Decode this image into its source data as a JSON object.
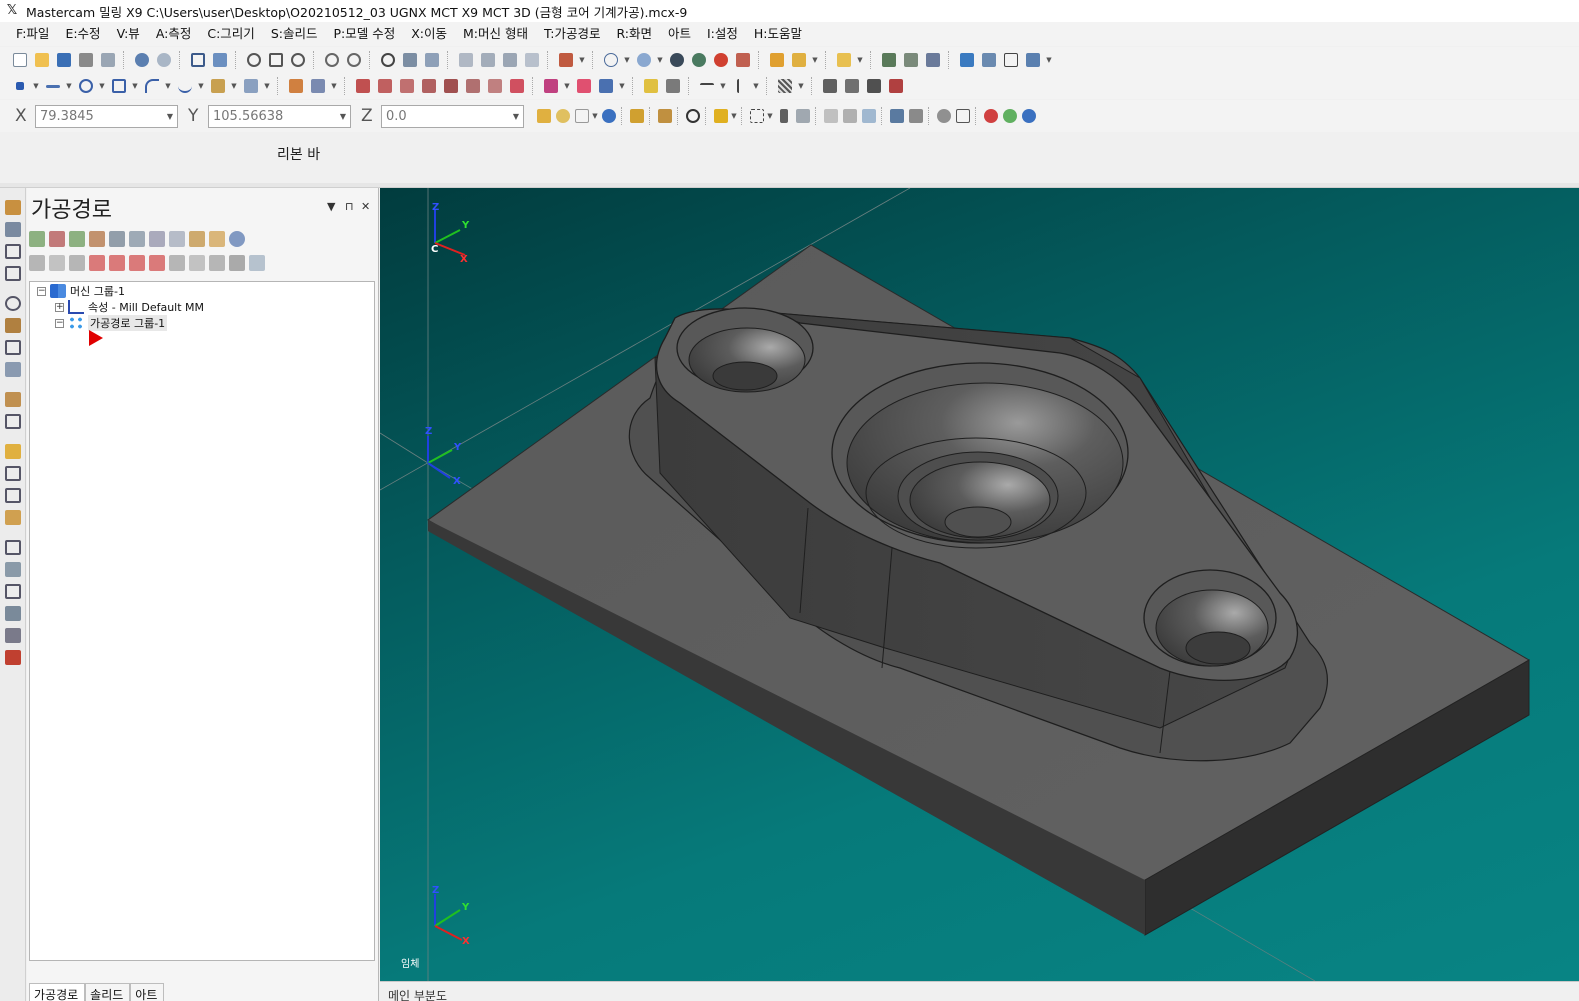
{
  "title_bar": {
    "text": "Mastercam 밀링 X9  C:\\Users\\user\\Desktop\\O20210512_03 UGNX MCT X9 MCT 3D (금형 코어 기계가공).mcx-9"
  },
  "menu": [
    "F:파일",
    "E:수정",
    "V:뷰",
    "A:측정",
    "C:그리기",
    "S:솔리드",
    "P:모델 수정",
    "X:이동",
    "M:머신 형태",
    "T:가공경로",
    "R:화면",
    "아트",
    "I:설정",
    "H:도움말"
  ],
  "coords": {
    "x_label": "X",
    "x_value": "79.3845",
    "y_label": "Y",
    "y_value": "105.56638",
    "z_label": "Z",
    "z_value": "0.0"
  },
  "ribbon": {
    "label": "리본 바"
  },
  "panel": {
    "title": "가공경로",
    "pin": "▾ ⊓ ✕"
  },
  "tree": {
    "machine_group": "머신 그룹-1",
    "properties": "속성 - Mill Default MM",
    "toolpath_group": "가공경로 그룹-1"
  },
  "bottom_tabs": [
    "가공경로",
    "솔리드",
    "아트"
  ],
  "viewport": {
    "view_label": "임체",
    "gnomon_top": {
      "z": "Z",
      "y": "Y",
      "x": "X",
      "c": "C"
    },
    "gnomon_origin": {
      "z": "Z",
      "y": "Y",
      "x": "X"
    },
    "gnomon_bottom": {
      "z": "Z",
      "y": "Y",
      "x": "X"
    }
  },
  "status": {
    "text": "메인 부분도"
  },
  "colors": {
    "viewport_top": "#013c3e",
    "viewport_bottom": "#088484",
    "solid_face": "#5c5c5c",
    "axis_x": "#e02020",
    "axis_y": "#20c020",
    "axis_z": "#2040e0",
    "cursor_arrow": "#e00000"
  }
}
